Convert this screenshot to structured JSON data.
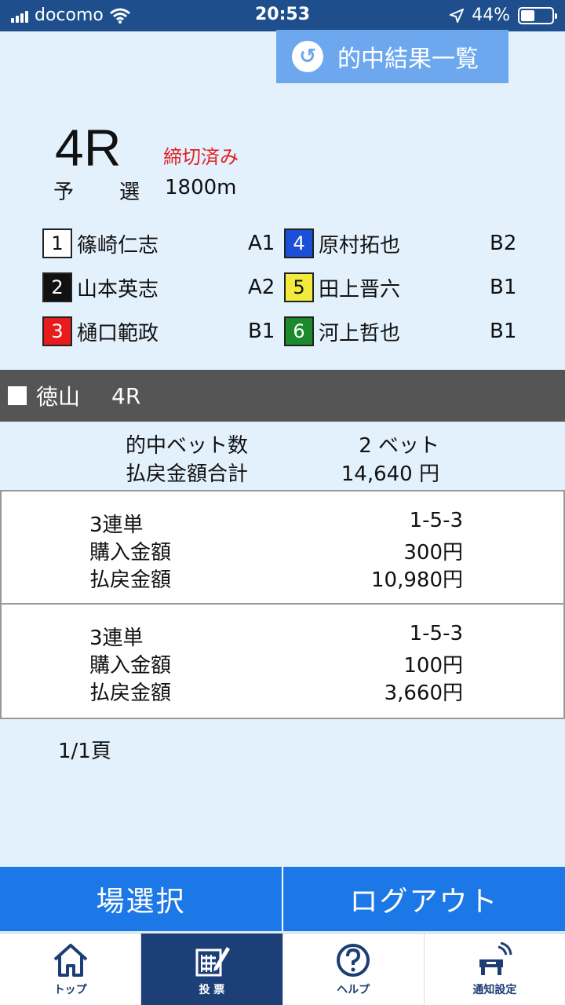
{
  "status": {
    "carrier": "docomo",
    "time": "20:53",
    "battery": "44%",
    "battery_level": 0.44
  },
  "header": {
    "results_button": "的中結果一覧"
  },
  "race": {
    "number": "4R",
    "status": "締切済み",
    "kind_a": "予",
    "kind_b": "選",
    "distance": "1800m"
  },
  "racers": [
    {
      "lane": "1",
      "name": "篠崎仁志",
      "grade": "A1",
      "color": "#ffffff",
      "text": "#111111"
    },
    {
      "lane": "2",
      "name": "山本英志",
      "grade": "A2",
      "color": "#111111",
      "text": "#ffffff"
    },
    {
      "lane": "3",
      "name": "樋口範政",
      "grade": "B1",
      "color": "#e81c1c",
      "text": "#ffffff"
    },
    {
      "lane": "4",
      "name": "原村拓也",
      "grade": "B2",
      "color": "#1c4fd8",
      "text": "#ffffff"
    },
    {
      "lane": "5",
      "name": "田上晋六",
      "grade": "B1",
      "color": "#f2ea3c",
      "text": "#111111"
    },
    {
      "lane": "6",
      "name": "河上哲也",
      "grade": "B1",
      "color": "#1a8a2c",
      "text": "#ffffff"
    }
  ],
  "venue": {
    "name": "徳山",
    "race": "4R"
  },
  "summary": {
    "hits_label": "的中ベット数",
    "hits_value": "2 ベット",
    "payout_label": "払戻金額合計",
    "payout_value": "14,640 円"
  },
  "bets": [
    {
      "type": "3連単",
      "combo": "1-5-3",
      "buy_label": "購入金額",
      "buy": "300円",
      "pay_label": "払戻金額",
      "pay": "10,980円"
    },
    {
      "type": "3連単",
      "combo": "1-5-3",
      "buy_label": "購入金額",
      "buy": "100円",
      "pay_label": "払戻金額",
      "pay": "3,660円"
    }
  ],
  "page": "1/1頁",
  "actions": {
    "select_venue": "場選択",
    "logout": "ログアウト"
  },
  "tabs": [
    {
      "label": "トップ",
      "icon": "home-icon"
    },
    {
      "label": "投 票",
      "icon": "vote-icon"
    },
    {
      "label": "ヘルプ",
      "icon": "help-icon"
    },
    {
      "label": "通知設定",
      "icon": "notification-icon"
    }
  ]
}
